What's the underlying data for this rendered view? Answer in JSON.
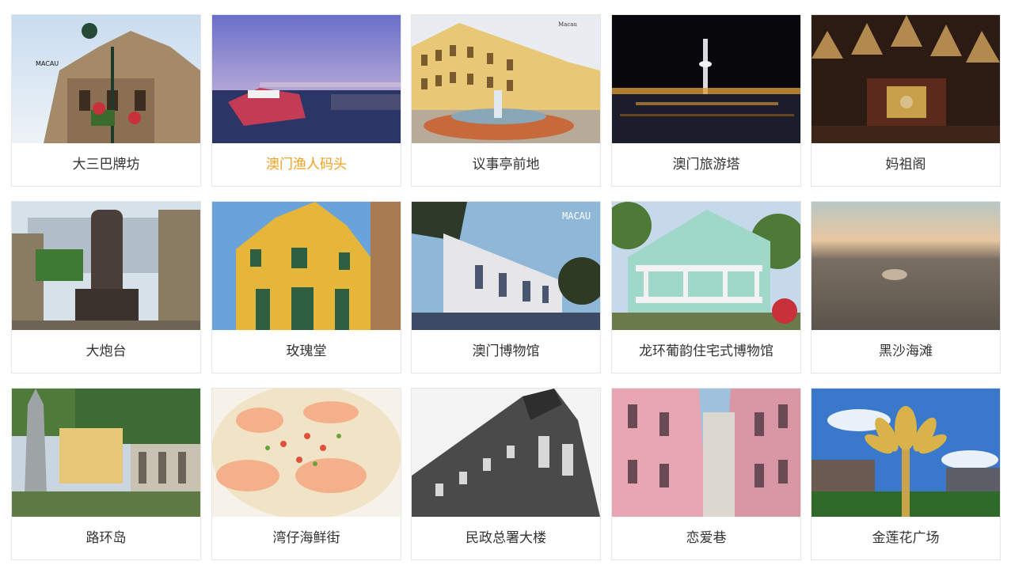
{
  "attractions": [
    {
      "label": "大三巴牌坊",
      "image_watermark": "MACAU"
    },
    {
      "label": "澳门渔人码头",
      "state": "hover"
    },
    {
      "label": "议事亭前地",
      "image_watermark": "Macau"
    },
    {
      "label": "澳门旅游塔"
    },
    {
      "label": "妈祖阁"
    },
    {
      "label": "大炮台"
    },
    {
      "label": "玫瑰堂"
    },
    {
      "label": "澳门博物馆",
      "image_watermark": "MACAU"
    },
    {
      "label": "龙环葡韵住宅式博物馆"
    },
    {
      "label": "黑沙海滩"
    },
    {
      "label": "路环岛"
    },
    {
      "label": "湾仔海鲜街"
    },
    {
      "label": "民政总署大楼"
    },
    {
      "label": "恋爱巷"
    },
    {
      "label": "金莲花广场"
    }
  ],
  "colors": {
    "label_text": "#333333",
    "label_active": "#f0a01e",
    "card_border": "#e6e6e6"
  }
}
